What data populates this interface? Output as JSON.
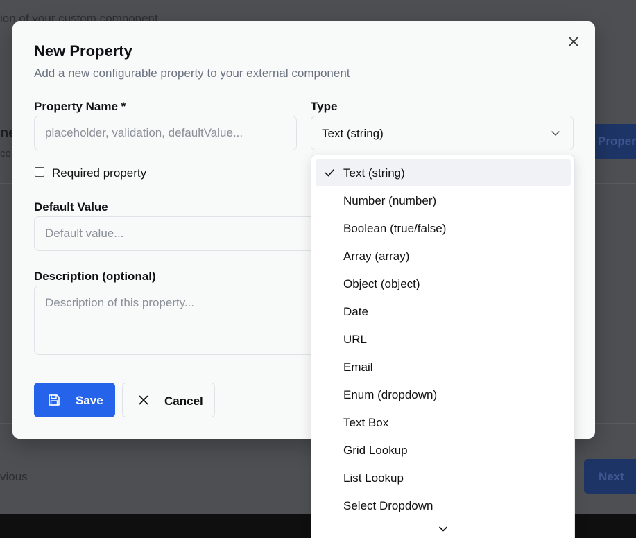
{
  "background": {
    "top_text": "ion of your custom component",
    "heading_fragment": "ne",
    "sub_fragment": "co",
    "property_button_fragment": "Proper",
    "previous_fragment": "vious",
    "next_label": "Next"
  },
  "modal": {
    "title": "New Property",
    "description": "Add a new configurable property to your external component",
    "property_name": {
      "label": "Property Name *",
      "placeholder": "placeholder, validation, defaultValue...",
      "value": ""
    },
    "type": {
      "label": "Type",
      "selected": "Text (string)"
    },
    "required": {
      "label": "Required property",
      "checked": false
    },
    "default_value": {
      "label": "Default Value",
      "placeholder": "Default value...",
      "value": ""
    },
    "description_field": {
      "label": "Description (optional)",
      "placeholder": "Description of this property...",
      "value": ""
    },
    "save_label": "Save",
    "cancel_label": "Cancel"
  },
  "dropdown": {
    "options": [
      {
        "label": "Text (string)",
        "selected": true
      },
      {
        "label": "Number (number)",
        "selected": false
      },
      {
        "label": "Boolean (true/false)",
        "selected": false
      },
      {
        "label": "Array (array)",
        "selected": false
      },
      {
        "label": "Object (object)",
        "selected": false
      },
      {
        "label": "Date",
        "selected": false
      },
      {
        "label": "URL",
        "selected": false
      },
      {
        "label": "Email",
        "selected": false
      },
      {
        "label": "Enum (dropdown)",
        "selected": false
      },
      {
        "label": "Text Box",
        "selected": false
      },
      {
        "label": "Grid Lookup",
        "selected": false
      },
      {
        "label": "List Lookup",
        "selected": false
      },
      {
        "label": "Select Dropdown",
        "selected": false
      }
    ]
  },
  "colors": {
    "primary": "#2563eb",
    "selected_option_bg": "#f0f2f6",
    "overlay": "#4d4f52"
  }
}
